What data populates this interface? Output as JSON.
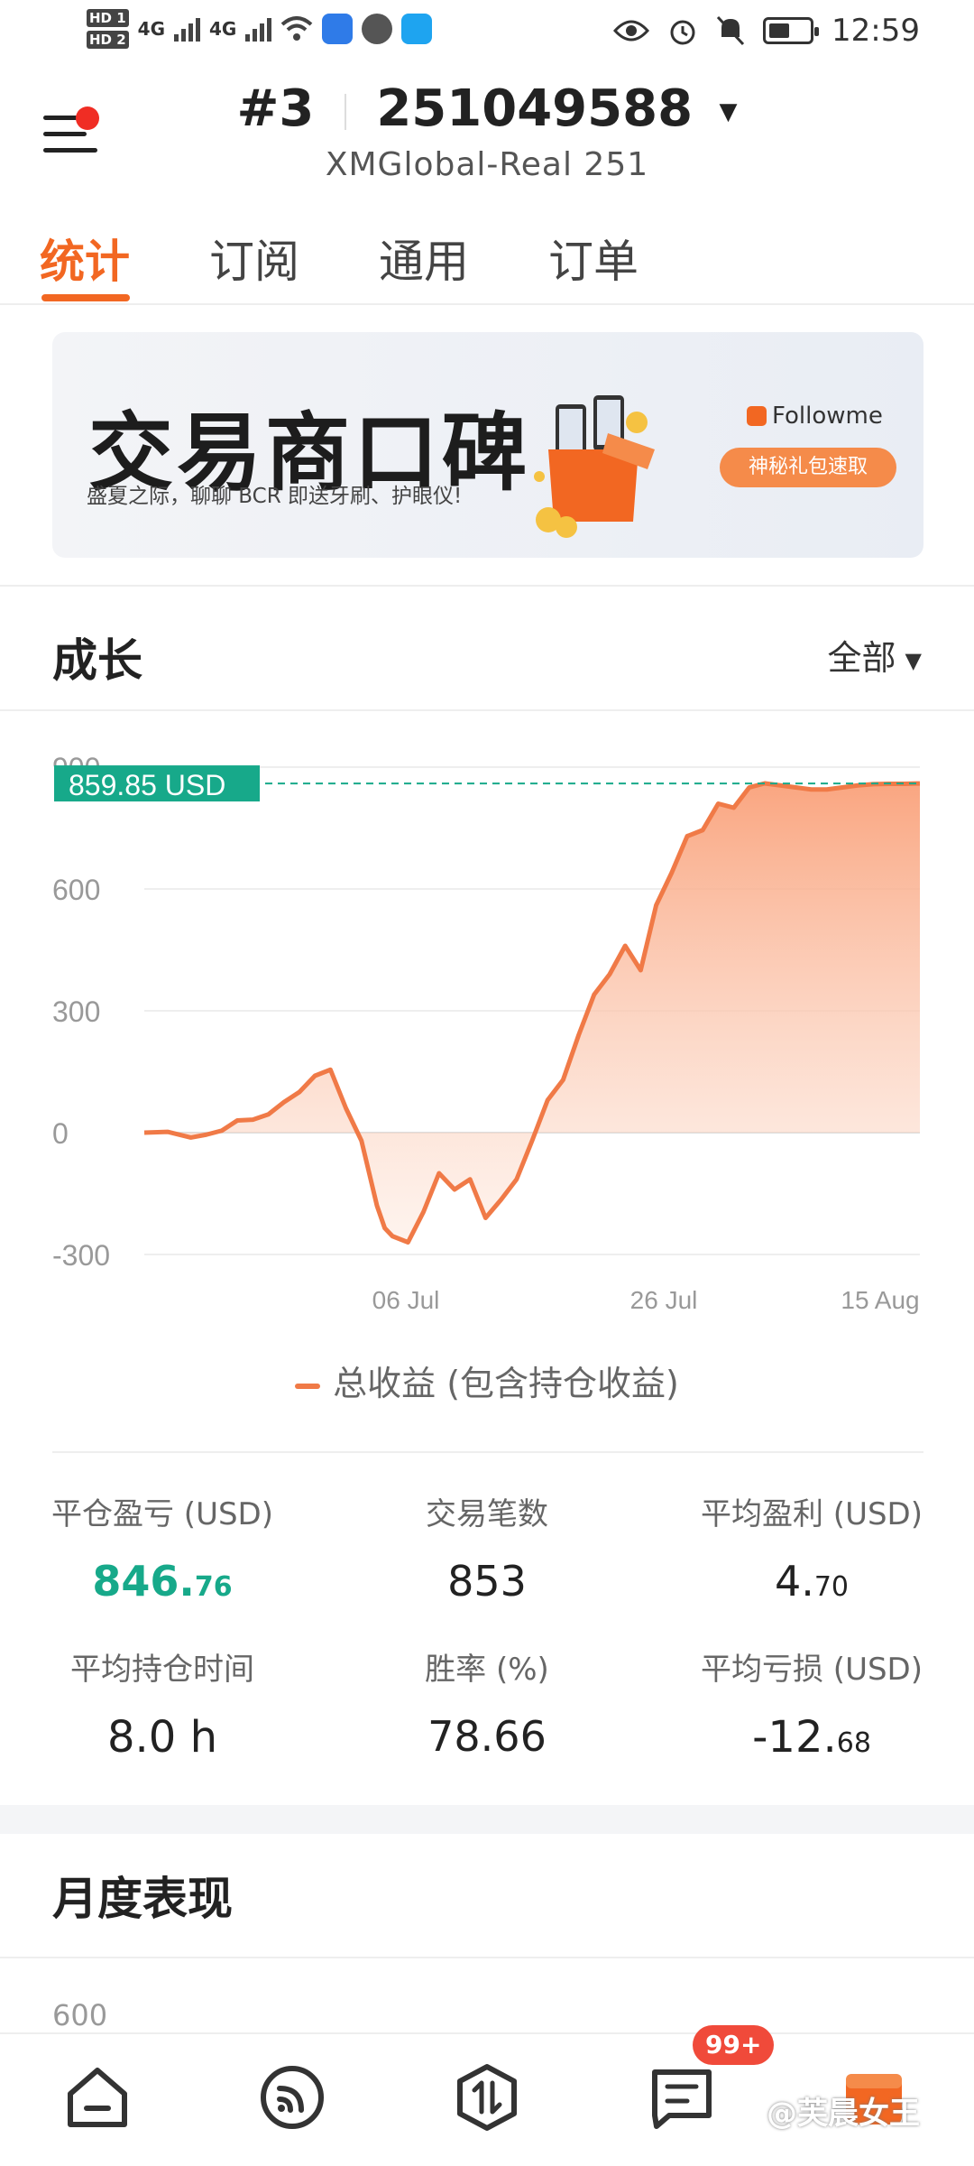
{
  "status_bar": {
    "hd1": "HD 1",
    "hd2": "HD 2",
    "net1": "4G",
    "net2": "4G",
    "time": "12:59"
  },
  "header": {
    "account_prefix": "#3",
    "account_number": "251049588",
    "server": "XMGlobal-Real 251"
  },
  "tabs": [
    {
      "label": "统计",
      "active": true
    },
    {
      "label": "订阅",
      "active": false
    },
    {
      "label": "通用",
      "active": false
    },
    {
      "label": "订单",
      "active": false
    }
  ],
  "banner": {
    "title": "交易商口碑",
    "subtitle": "盛夏之际，聊聊 BCR 即送牙刷、护眼仪!",
    "brand": "Followme",
    "button": "神秘礼包速取"
  },
  "growth": {
    "title": "成长",
    "range": "全部",
    "current_label": "859.85 USD",
    "legend": "总收益 (包含持仓收益)"
  },
  "chart_data": {
    "type": "area",
    "series": [
      {
        "name": "总收益 (包含持仓收益)",
        "x_index": [
          0,
          3,
          6,
          8,
          10,
          12,
          14,
          16,
          18,
          20,
          22,
          24,
          26,
          28,
          30,
          31,
          32,
          34,
          36,
          38,
          40,
          42,
          44,
          46,
          48,
          50,
          52,
          54,
          56,
          58,
          60,
          62,
          64,
          66,
          68,
          70,
          72,
          74,
          76,
          78,
          80,
          82,
          84,
          86,
          88,
          90,
          92,
          94,
          96,
          98,
          100
        ],
        "values": [
          0,
          2,
          -12,
          -5,
          5,
          30,
          32,
          45,
          75,
          100,
          140,
          155,
          60,
          -20,
          -180,
          -235,
          -255,
          -270,
          -195,
          -100,
          -140,
          -115,
          -210,
          -165,
          -115,
          -20,
          80,
          130,
          240,
          340,
          390,
          460,
          400,
          560,
          640,
          730,
          745,
          810,
          800,
          850,
          860,
          855,
          850,
          845,
          845,
          850,
          855,
          858,
          859,
          859,
          859.85
        ],
        "color": "#f07a47"
      }
    ],
    "x_ticks": [
      "06 Jul",
      "26 Jul",
      "15 Aug"
    ],
    "y_ticks": [
      900,
      600,
      300,
      0,
      -300
    ],
    "ylim": [
      -300,
      900
    ],
    "current_value": 859.85,
    "title": "",
    "xlabel": "",
    "ylabel": "",
    "grid": true
  },
  "stats": [
    {
      "label": "平仓盈亏 (USD)",
      "int": "846.",
      "dec": "76",
      "style": "green"
    },
    {
      "label": "交易笔数",
      "int": "853",
      "dec": "",
      "style": "normal"
    },
    {
      "label": "平均盈利 (USD)",
      "int": "4.",
      "dec": "70",
      "style": "normal"
    },
    {
      "label": "平均持仓时间",
      "int": "8.0 h",
      "dec": "",
      "style": "normal"
    },
    {
      "label": "胜率 (%)",
      "int": "78.66",
      "dec": "",
      "style": "normal"
    },
    {
      "label": "平均亏损 (USD)",
      "int": "-12.",
      "dec": "68",
      "style": "normal"
    }
  ],
  "monthly": {
    "title": "月度表现",
    "first_tick": "600"
  },
  "bottom_nav": {
    "badge": "99+",
    "watermark": "@芙晨女王",
    "items": [
      "home-icon",
      "subscription-icon",
      "trade-icon",
      "messages-icon",
      "calendar-icon"
    ]
  },
  "colors": {
    "accent": "#f26722",
    "positive": "#17a98a",
    "line": "#f07a47"
  }
}
